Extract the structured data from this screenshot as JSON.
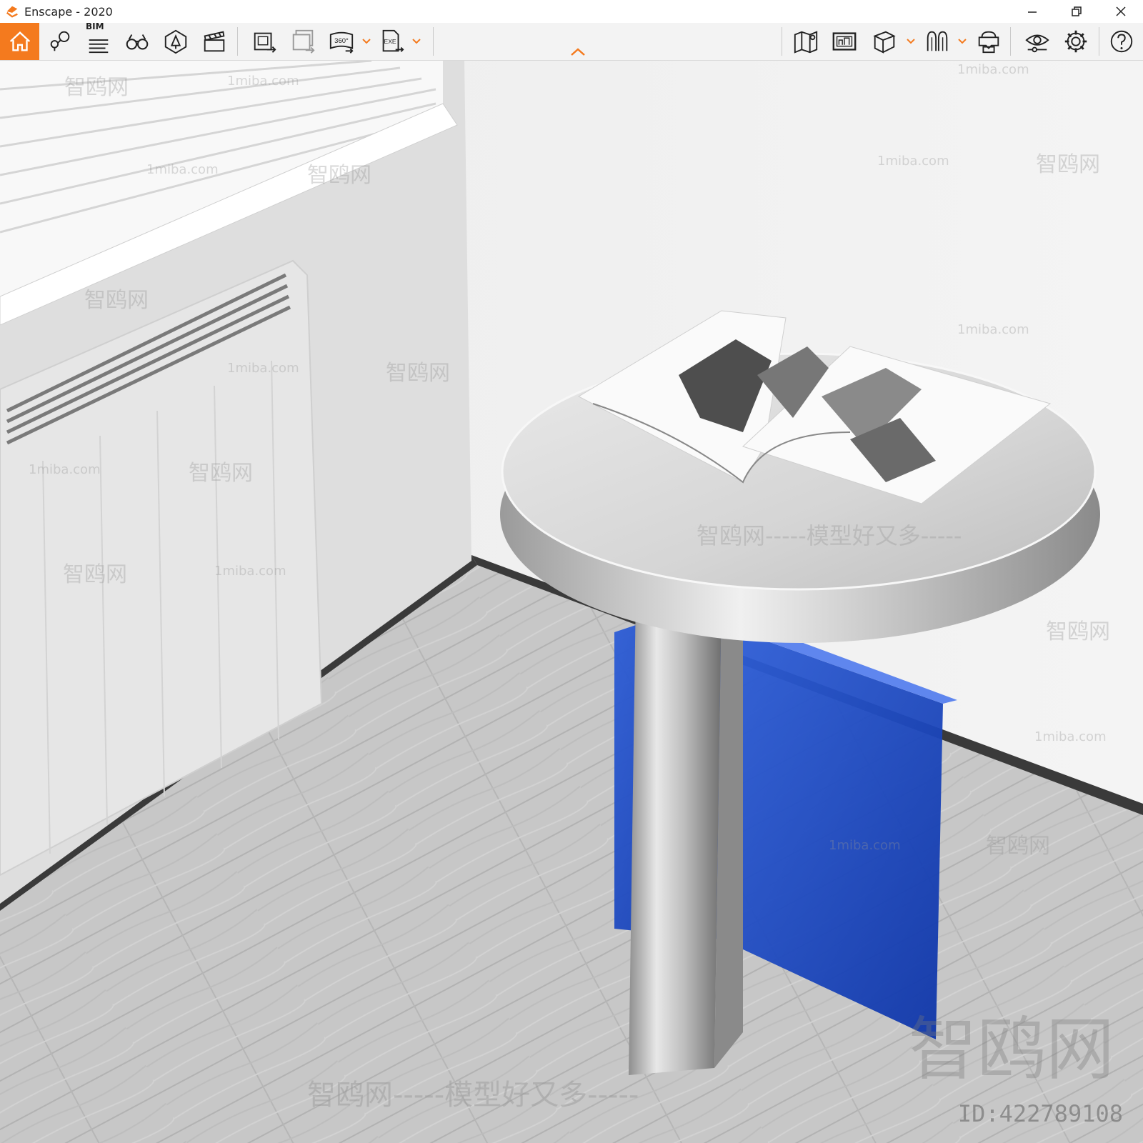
{
  "window": {
    "title": "Enscape - 2020",
    "controls": [
      "minimize",
      "restore",
      "close"
    ]
  },
  "toolbar": {
    "accent_color": "#f47a1e",
    "left_buttons": [
      {
        "name": "home-icon"
      },
      {
        "name": "location-pins-icon"
      },
      {
        "name": "bim-info-icon",
        "label": "BIM"
      },
      {
        "name": "binoculars-icon"
      },
      {
        "name": "asset-library-icon"
      },
      {
        "name": "video-editor-icon"
      },
      {
        "name": "screenshot-export-icon"
      },
      {
        "name": "batch-export-icon"
      },
      {
        "name": "panorama-360-icon",
        "label": "360°",
        "has_dropdown": true
      },
      {
        "name": "exe-export-icon",
        "label": "EXE",
        "has_dropdown": true
      }
    ],
    "right_buttons": [
      {
        "name": "map-icon"
      },
      {
        "name": "views-manager-icon"
      },
      {
        "name": "cube-view-icon",
        "has_dropdown": true
      },
      {
        "name": "material-editor-icon",
        "has_dropdown": true
      },
      {
        "name": "vr-headset-icon"
      },
      {
        "name": "visual-settings-icon"
      },
      {
        "name": "settings-gear-icon"
      },
      {
        "name": "help-icon"
      }
    ]
  },
  "viewport": {
    "watermarks": {
      "site": "1miba.com",
      "cn_short": "智鸥网",
      "cn_long": "智鸥网-----模型好又多-----",
      "id_text": "ID:422789108"
    }
  }
}
